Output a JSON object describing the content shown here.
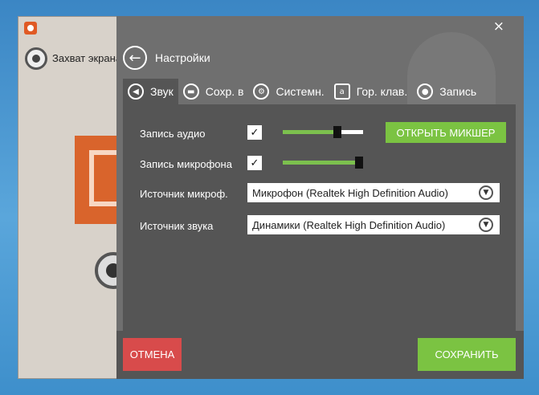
{
  "background_app": {
    "title": "Захват экрана"
  },
  "window": {
    "close_icon": "×"
  },
  "header": {
    "back_icon": "arrow-left-icon",
    "title": "Настройки"
  },
  "tabs": [
    {
      "label": "Звук",
      "icon": "speaker-icon",
      "glyph": "◀",
      "active": true
    },
    {
      "label": "Сохр. в",
      "icon": "folder-icon",
      "glyph": "▬",
      "active": false
    },
    {
      "label": "Системн.",
      "icon": "gears-icon",
      "glyph": "⚙",
      "active": false
    },
    {
      "label": "Гор. клав.",
      "icon": "keyboard-icon",
      "glyph": "a",
      "active": false
    },
    {
      "label": "Запись",
      "icon": "record-icon",
      "glyph": "●",
      "active": false
    }
  ],
  "audio": {
    "record_audio_label": "Запись аудио",
    "record_audio_checked": true,
    "audio_volume_fraction": 0.68,
    "mixer_button": "ОТКРЫТЬ МИКШЕР",
    "record_mic_label": "Запись микрофона",
    "record_mic_checked": true,
    "mic_volume_fraction": 0.95,
    "mic_source_label": "Источник микроф.",
    "mic_source_value": "Микрофон (Realtek High Definition Audio)",
    "sound_source_label": "Источник звука",
    "sound_source_value": "Динамики (Realtek High Definition Audio)"
  },
  "footer": {
    "cancel": "ОТМЕНА",
    "save": "СОХРАНИТЬ"
  },
  "colors": {
    "accent_green": "#7bc342",
    "cancel_red": "#d84b4b",
    "panel_gray": "#6f6f6f",
    "content_gray": "#555555"
  }
}
